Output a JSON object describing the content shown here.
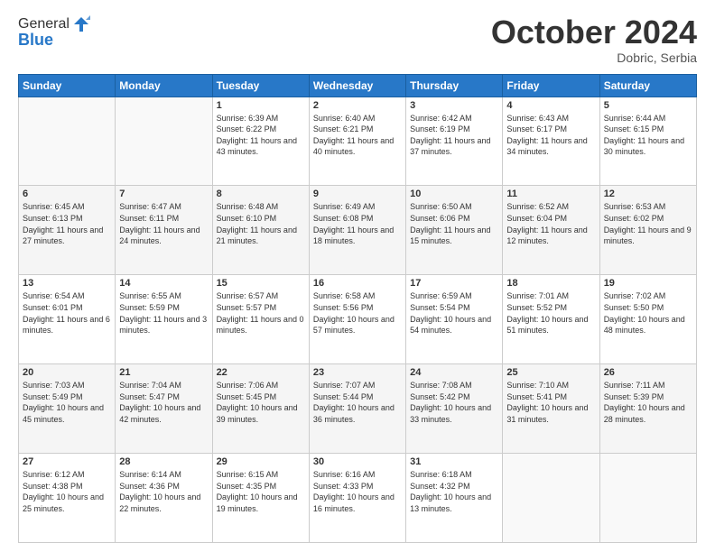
{
  "header": {
    "logo_general": "General",
    "logo_blue": "Blue",
    "month": "October 2024",
    "location": "Dobric, Serbia"
  },
  "days_of_week": [
    "Sunday",
    "Monday",
    "Tuesday",
    "Wednesday",
    "Thursday",
    "Friday",
    "Saturday"
  ],
  "weeks": [
    [
      {
        "day": "",
        "sunrise": "",
        "sunset": "",
        "daylight": ""
      },
      {
        "day": "",
        "sunrise": "",
        "sunset": "",
        "daylight": ""
      },
      {
        "day": "1",
        "sunrise": "Sunrise: 6:39 AM",
        "sunset": "Sunset: 6:22 PM",
        "daylight": "Daylight: 11 hours and 43 minutes."
      },
      {
        "day": "2",
        "sunrise": "Sunrise: 6:40 AM",
        "sunset": "Sunset: 6:21 PM",
        "daylight": "Daylight: 11 hours and 40 minutes."
      },
      {
        "day": "3",
        "sunrise": "Sunrise: 6:42 AM",
        "sunset": "Sunset: 6:19 PM",
        "daylight": "Daylight: 11 hours and 37 minutes."
      },
      {
        "day": "4",
        "sunrise": "Sunrise: 6:43 AM",
        "sunset": "Sunset: 6:17 PM",
        "daylight": "Daylight: 11 hours and 34 minutes."
      },
      {
        "day": "5",
        "sunrise": "Sunrise: 6:44 AM",
        "sunset": "Sunset: 6:15 PM",
        "daylight": "Daylight: 11 hours and 30 minutes."
      }
    ],
    [
      {
        "day": "6",
        "sunrise": "Sunrise: 6:45 AM",
        "sunset": "Sunset: 6:13 PM",
        "daylight": "Daylight: 11 hours and 27 minutes."
      },
      {
        "day": "7",
        "sunrise": "Sunrise: 6:47 AM",
        "sunset": "Sunset: 6:11 PM",
        "daylight": "Daylight: 11 hours and 24 minutes."
      },
      {
        "day": "8",
        "sunrise": "Sunrise: 6:48 AM",
        "sunset": "Sunset: 6:10 PM",
        "daylight": "Daylight: 11 hours and 21 minutes."
      },
      {
        "day": "9",
        "sunrise": "Sunrise: 6:49 AM",
        "sunset": "Sunset: 6:08 PM",
        "daylight": "Daylight: 11 hours and 18 minutes."
      },
      {
        "day": "10",
        "sunrise": "Sunrise: 6:50 AM",
        "sunset": "Sunset: 6:06 PM",
        "daylight": "Daylight: 11 hours and 15 minutes."
      },
      {
        "day": "11",
        "sunrise": "Sunrise: 6:52 AM",
        "sunset": "Sunset: 6:04 PM",
        "daylight": "Daylight: 11 hours and 12 minutes."
      },
      {
        "day": "12",
        "sunrise": "Sunrise: 6:53 AM",
        "sunset": "Sunset: 6:02 PM",
        "daylight": "Daylight: 11 hours and 9 minutes."
      }
    ],
    [
      {
        "day": "13",
        "sunrise": "Sunrise: 6:54 AM",
        "sunset": "Sunset: 6:01 PM",
        "daylight": "Daylight: 11 hours and 6 minutes."
      },
      {
        "day": "14",
        "sunrise": "Sunrise: 6:55 AM",
        "sunset": "Sunset: 5:59 PM",
        "daylight": "Daylight: 11 hours and 3 minutes."
      },
      {
        "day": "15",
        "sunrise": "Sunrise: 6:57 AM",
        "sunset": "Sunset: 5:57 PM",
        "daylight": "Daylight: 11 hours and 0 minutes."
      },
      {
        "day": "16",
        "sunrise": "Sunrise: 6:58 AM",
        "sunset": "Sunset: 5:56 PM",
        "daylight": "Daylight: 10 hours and 57 minutes."
      },
      {
        "day": "17",
        "sunrise": "Sunrise: 6:59 AM",
        "sunset": "Sunset: 5:54 PM",
        "daylight": "Daylight: 10 hours and 54 minutes."
      },
      {
        "day": "18",
        "sunrise": "Sunrise: 7:01 AM",
        "sunset": "Sunset: 5:52 PM",
        "daylight": "Daylight: 10 hours and 51 minutes."
      },
      {
        "day": "19",
        "sunrise": "Sunrise: 7:02 AM",
        "sunset": "Sunset: 5:50 PM",
        "daylight": "Daylight: 10 hours and 48 minutes."
      }
    ],
    [
      {
        "day": "20",
        "sunrise": "Sunrise: 7:03 AM",
        "sunset": "Sunset: 5:49 PM",
        "daylight": "Daylight: 10 hours and 45 minutes."
      },
      {
        "day": "21",
        "sunrise": "Sunrise: 7:04 AM",
        "sunset": "Sunset: 5:47 PM",
        "daylight": "Daylight: 10 hours and 42 minutes."
      },
      {
        "day": "22",
        "sunrise": "Sunrise: 7:06 AM",
        "sunset": "Sunset: 5:45 PM",
        "daylight": "Daylight: 10 hours and 39 minutes."
      },
      {
        "day": "23",
        "sunrise": "Sunrise: 7:07 AM",
        "sunset": "Sunset: 5:44 PM",
        "daylight": "Daylight: 10 hours and 36 minutes."
      },
      {
        "day": "24",
        "sunrise": "Sunrise: 7:08 AM",
        "sunset": "Sunset: 5:42 PM",
        "daylight": "Daylight: 10 hours and 33 minutes."
      },
      {
        "day": "25",
        "sunrise": "Sunrise: 7:10 AM",
        "sunset": "Sunset: 5:41 PM",
        "daylight": "Daylight: 10 hours and 31 minutes."
      },
      {
        "day": "26",
        "sunrise": "Sunrise: 7:11 AM",
        "sunset": "Sunset: 5:39 PM",
        "daylight": "Daylight: 10 hours and 28 minutes."
      }
    ],
    [
      {
        "day": "27",
        "sunrise": "Sunrise: 6:12 AM",
        "sunset": "Sunset: 4:38 PM",
        "daylight": "Daylight: 10 hours and 25 minutes."
      },
      {
        "day": "28",
        "sunrise": "Sunrise: 6:14 AM",
        "sunset": "Sunset: 4:36 PM",
        "daylight": "Daylight: 10 hours and 22 minutes."
      },
      {
        "day": "29",
        "sunrise": "Sunrise: 6:15 AM",
        "sunset": "Sunset: 4:35 PM",
        "daylight": "Daylight: 10 hours and 19 minutes."
      },
      {
        "day": "30",
        "sunrise": "Sunrise: 6:16 AM",
        "sunset": "Sunset: 4:33 PM",
        "daylight": "Daylight: 10 hours and 16 minutes."
      },
      {
        "day": "31",
        "sunrise": "Sunrise: 6:18 AM",
        "sunset": "Sunset: 4:32 PM",
        "daylight": "Daylight: 10 hours and 13 minutes."
      },
      {
        "day": "",
        "sunrise": "",
        "sunset": "",
        "daylight": ""
      },
      {
        "day": "",
        "sunrise": "",
        "sunset": "",
        "daylight": ""
      }
    ]
  ]
}
